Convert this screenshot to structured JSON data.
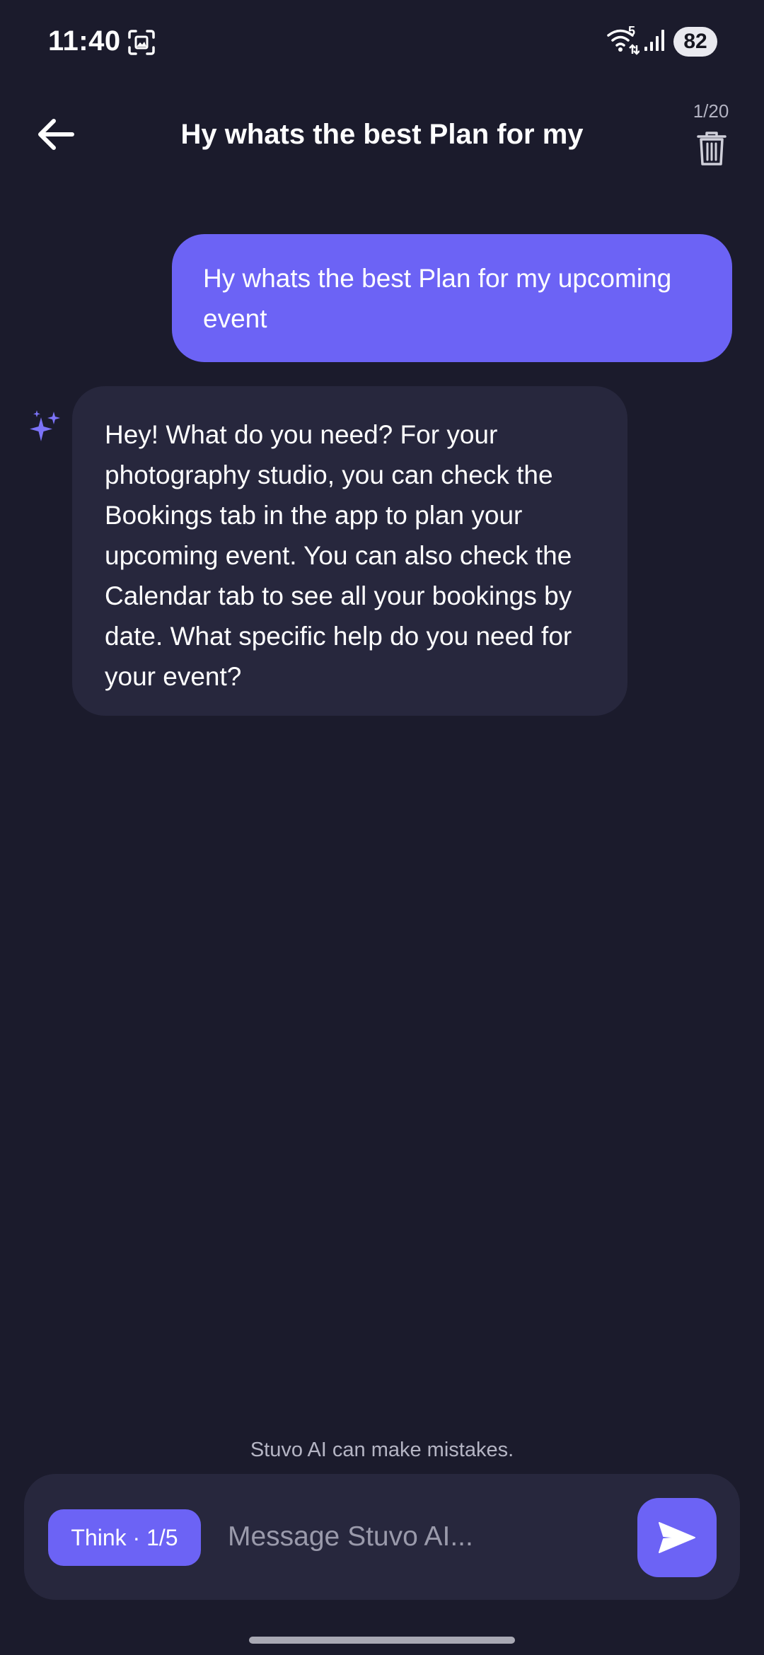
{
  "status_bar": {
    "time": "11:40",
    "wifi_badge": "5",
    "battery": "82",
    "icons": [
      "screenshot-icon",
      "wifi-icon",
      "signal-icon"
    ]
  },
  "header": {
    "title": "Hy whats the best Plan for my",
    "counter": "1/20",
    "icons": [
      "back-arrow-icon",
      "trash-icon"
    ]
  },
  "messages": [
    {
      "role": "user",
      "text": "Hy whats the best Plan for my upcoming event"
    },
    {
      "role": "assistant",
      "icon": "sparkle-icon",
      "text": "Hey! What do you need? For your photography studio, you can check the Bookings tab in the app to plan your upcoming event. You can also check the Calendar tab to see all your bookings by date. What specific help do you need for your event?"
    }
  ],
  "footer": {
    "disclaimer": "Stuvo AI can make mistakes.",
    "think_label": "Think · 1/5",
    "input_placeholder": "Message Stuvo AI...",
    "input_value": "",
    "send_icon": "send-icon"
  },
  "colors": {
    "background": "#1b1b2c",
    "accent": "#6c63f5",
    "surface": "#27273d",
    "muted_text": "#b5b5c4"
  }
}
